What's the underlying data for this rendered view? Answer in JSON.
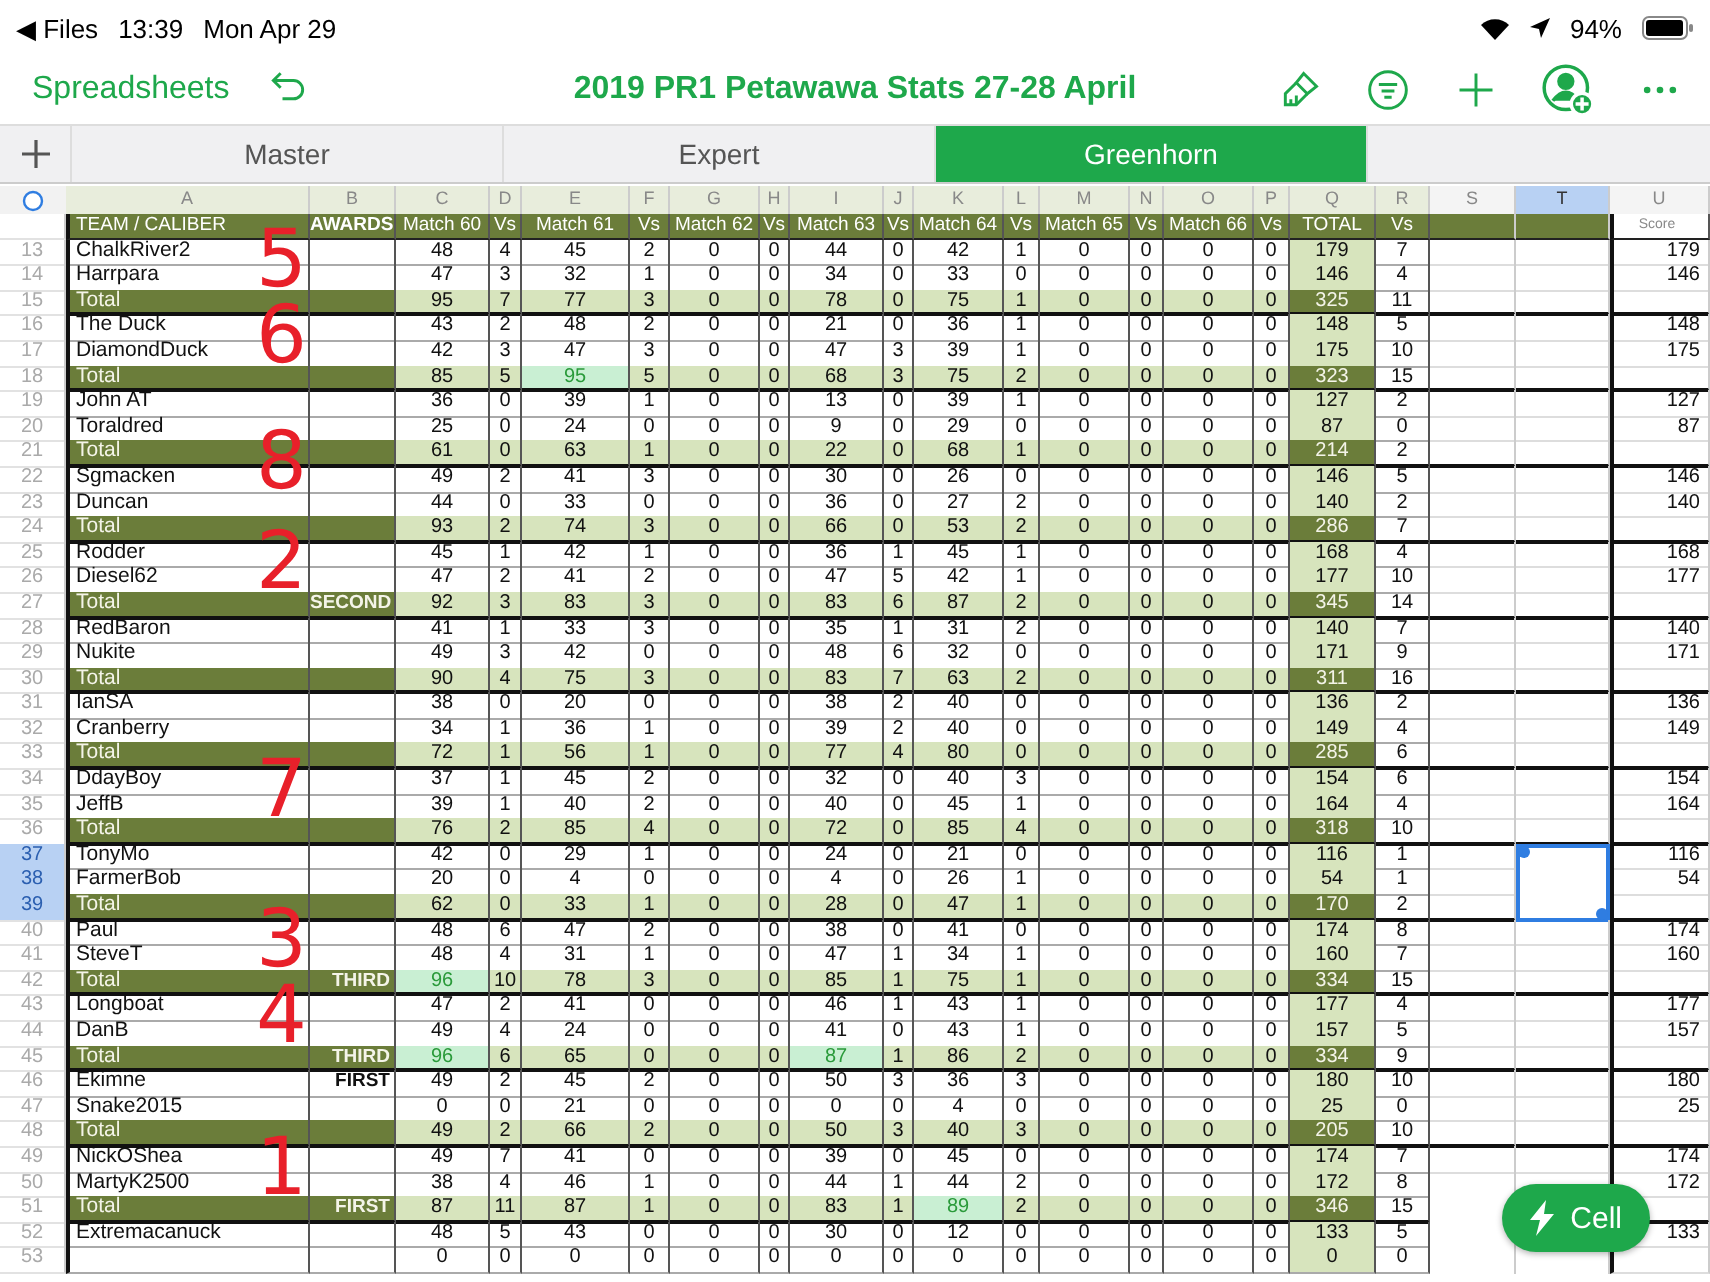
{
  "status_bar": {
    "back": "◀ Files",
    "time": "13:39",
    "date": "Mon Apr 29",
    "battery": "94%"
  },
  "toolbar": {
    "back": "Spreadsheets",
    "title": "2019 PR1 Petawawa Stats 27-28 April"
  },
  "tabs": [
    {
      "label": "Master",
      "selected": false
    },
    {
      "label": "Expert",
      "selected": false
    },
    {
      "label": "Greenhorn",
      "selected": true
    }
  ],
  "column_headers": [
    {
      "label": "A",
      "selected": false
    },
    {
      "label": "B",
      "selected": false
    },
    {
      "label": "C",
      "selected": false
    },
    {
      "label": "D",
      "selected": false
    },
    {
      "label": "E",
      "selected": false
    },
    {
      "label": "F",
      "selected": false
    },
    {
      "label": "G",
      "selected": false
    },
    {
      "label": "H",
      "selected": false
    },
    {
      "label": "I",
      "selected": false
    },
    {
      "label": "J",
      "selected": false
    },
    {
      "label": "K",
      "selected": false
    },
    {
      "label": "L",
      "selected": false
    },
    {
      "label": "M",
      "selected": false
    },
    {
      "label": "N",
      "selected": false
    },
    {
      "label": "O",
      "selected": false
    },
    {
      "label": "P",
      "selected": false
    },
    {
      "label": "Q",
      "selected": false
    },
    {
      "label": "R",
      "selected": false
    },
    {
      "label": "S",
      "selected": false
    },
    {
      "label": "T",
      "selected": true
    },
    {
      "label": "U",
      "selected": false
    }
  ],
  "header_row": [
    "TEAM / CALIBER",
    "AWARDS",
    "Match 60",
    "Vs",
    "Match 61",
    "Vs",
    "Match 62",
    "Vs",
    "Match 63",
    "Vs",
    "Match 64",
    "Vs",
    "Match 65",
    "Vs",
    "Match 66",
    "Vs",
    "TOTAL",
    "Vs"
  ],
  "score_header": "Score",
  "rows": [
    {
      "num": "13",
      "kind": "player",
      "selected": false,
      "name": "ChalkRiver2",
      "cells": [
        "48",
        "4",
        "45",
        "2",
        "0",
        "0",
        "44",
        "0",
        "42",
        "1",
        "0",
        "0",
        "0",
        "0",
        "179",
        "7"
      ],
      "highlighted": [
        false,
        false,
        false,
        false,
        false,
        false,
        false,
        false,
        false,
        false,
        false,
        false,
        false,
        false,
        false,
        false
      ],
      "score": "179"
    },
    {
      "num": "14",
      "kind": "player",
      "selected": false,
      "name": "Harrpara",
      "cells": [
        "47",
        "3",
        "32",
        "1",
        "0",
        "0",
        "34",
        "0",
        "33",
        "0",
        "0",
        "0",
        "0",
        "0",
        "146",
        "4"
      ],
      "highlighted": [
        false,
        false,
        false,
        false,
        false,
        false,
        false,
        false,
        false,
        false,
        false,
        false,
        false,
        false,
        false,
        false
      ],
      "score": "146",
      "ink": "5"
    },
    {
      "num": "15",
      "kind": "total",
      "selected": false,
      "name": "Total",
      "cells": [
        "95",
        "7",
        "77",
        "3",
        "0",
        "0",
        "78",
        "0",
        "75",
        "1",
        "0",
        "0",
        "0",
        "0",
        "325",
        "11"
      ],
      "highlighted": [
        false,
        false,
        false,
        false,
        false,
        false,
        false,
        false,
        false,
        false,
        false,
        false,
        false,
        false,
        false,
        false
      ]
    },
    {
      "num": "16",
      "kind": "player",
      "selected": false,
      "name": "The Duck",
      "cells": [
        "43",
        "2",
        "48",
        "2",
        "0",
        "0",
        "21",
        "0",
        "36",
        "1",
        "0",
        "0",
        "0",
        "0",
        "148",
        "5"
      ],
      "highlighted": [
        false,
        false,
        false,
        false,
        false,
        false,
        false,
        false,
        false,
        false,
        false,
        false,
        false,
        false,
        false,
        false
      ],
      "score": "148"
    },
    {
      "num": "17",
      "kind": "player",
      "selected": false,
      "name": "DiamondDuck",
      "cells": [
        "42",
        "3",
        "47",
        "3",
        "0",
        "0",
        "47",
        "3",
        "39",
        "1",
        "0",
        "0",
        "0",
        "0",
        "175",
        "10"
      ],
      "highlighted": [
        false,
        false,
        false,
        false,
        false,
        false,
        false,
        false,
        false,
        false,
        false,
        false,
        false,
        false,
        false,
        false
      ],
      "score": "175",
      "ink": "6"
    },
    {
      "num": "18",
      "kind": "total",
      "selected": false,
      "name": "Total",
      "cells": [
        "85",
        "5",
        "95",
        "5",
        "0",
        "0",
        "68",
        "3",
        "75",
        "2",
        "0",
        "0",
        "0",
        "0",
        "323",
        "15"
      ],
      "highlighted": [
        false,
        false,
        true,
        false,
        false,
        false,
        false,
        false,
        false,
        false,
        false,
        false,
        false,
        false,
        false,
        false
      ]
    },
    {
      "num": "19",
      "kind": "player",
      "selected": false,
      "name": "John AT",
      "cells": [
        "36",
        "0",
        "39",
        "1",
        "0",
        "0",
        "13",
        "0",
        "39",
        "1",
        "0",
        "0",
        "0",
        "0",
        "127",
        "2"
      ],
      "highlighted": [
        false,
        false,
        false,
        false,
        false,
        false,
        false,
        false,
        false,
        false,
        false,
        false,
        false,
        false,
        false,
        false
      ],
      "score": "127"
    },
    {
      "num": "20",
      "kind": "player",
      "selected": false,
      "name": "Toraldred",
      "cells": [
        "25",
        "0",
        "24",
        "0",
        "0",
        "0",
        "9",
        "0",
        "29",
        "0",
        "0",
        "0",
        "0",
        "0",
        "87",
        "0"
      ],
      "highlighted": [
        false,
        false,
        false,
        false,
        false,
        false,
        false,
        false,
        false,
        false,
        false,
        false,
        false,
        false,
        false,
        false
      ],
      "score": "87"
    },
    {
      "num": "21",
      "kind": "total",
      "selected": false,
      "name": "Total",
      "cells": [
        "61",
        "0",
        "63",
        "1",
        "0",
        "0",
        "22",
        "0",
        "68",
        "1",
        "0",
        "0",
        "0",
        "0",
        "214",
        "2"
      ],
      "highlighted": [
        false,
        false,
        false,
        false,
        false,
        false,
        false,
        false,
        false,
        false,
        false,
        false,
        false,
        false,
        false,
        false
      ]
    },
    {
      "num": "22",
      "kind": "player",
      "selected": false,
      "name": "Sgmacken",
      "cells": [
        "49",
        "2",
        "41",
        "3",
        "0",
        "0",
        "30",
        "0",
        "26",
        "0",
        "0",
        "0",
        "0",
        "0",
        "146",
        "5"
      ],
      "highlighted": [
        false,
        false,
        false,
        false,
        false,
        false,
        false,
        false,
        false,
        false,
        false,
        false,
        false,
        false,
        false,
        false
      ],
      "score": "146",
      "ink": "8"
    },
    {
      "num": "23",
      "kind": "player",
      "selected": false,
      "name": "Duncan",
      "cells": [
        "44",
        "0",
        "33",
        "0",
        "0",
        "0",
        "36",
        "0",
        "27",
        "2",
        "0",
        "0",
        "0",
        "0",
        "140",
        "2"
      ],
      "highlighted": [
        false,
        false,
        false,
        false,
        false,
        false,
        false,
        false,
        false,
        false,
        false,
        false,
        false,
        false,
        false,
        false
      ],
      "score": "140"
    },
    {
      "num": "24",
      "kind": "total",
      "selected": false,
      "name": "Total",
      "cells": [
        "93",
        "2",
        "74",
        "3",
        "0",
        "0",
        "66",
        "0",
        "53",
        "2",
        "0",
        "0",
        "0",
        "0",
        "286",
        "7"
      ],
      "highlighted": [
        false,
        false,
        false,
        false,
        false,
        false,
        false,
        false,
        false,
        false,
        false,
        false,
        false,
        false,
        false,
        false
      ]
    },
    {
      "num": "25",
      "kind": "player",
      "selected": false,
      "name": "Rodder",
      "cells": [
        "45",
        "1",
        "42",
        "1",
        "0",
        "0",
        "36",
        "1",
        "45",
        "1",
        "0",
        "0",
        "0",
        "0",
        "168",
        "4"
      ],
      "highlighted": [
        false,
        false,
        false,
        false,
        false,
        false,
        false,
        false,
        false,
        false,
        false,
        false,
        false,
        false,
        false,
        false
      ],
      "score": "168"
    },
    {
      "num": "26",
      "kind": "player",
      "selected": false,
      "name": "Diesel62",
      "cells": [
        "47",
        "2",
        "41",
        "2",
        "0",
        "0",
        "47",
        "5",
        "42",
        "1",
        "0",
        "0",
        "0",
        "0",
        "177",
        "10"
      ],
      "highlighted": [
        false,
        false,
        false,
        false,
        false,
        false,
        false,
        false,
        false,
        false,
        false,
        false,
        false,
        false,
        false,
        false
      ],
      "score": "177",
      "ink": "2"
    },
    {
      "num": "27",
      "kind": "total",
      "selected": false,
      "name": "Total",
      "award": "SECOND",
      "cells": [
        "92",
        "3",
        "83",
        "3",
        "0",
        "0",
        "83",
        "6",
        "87",
        "2",
        "0",
        "0",
        "0",
        "0",
        "345",
        "14"
      ],
      "highlighted": [
        false,
        false,
        false,
        false,
        false,
        false,
        false,
        false,
        false,
        false,
        false,
        false,
        false,
        false,
        false,
        false
      ]
    },
    {
      "num": "28",
      "kind": "player",
      "selected": false,
      "name": "RedBaron",
      "cells": [
        "41",
        "1",
        "33",
        "3",
        "0",
        "0",
        "35",
        "1",
        "31",
        "2",
        "0",
        "0",
        "0",
        "0",
        "140",
        "7"
      ],
      "highlighted": [
        false,
        false,
        false,
        false,
        false,
        false,
        false,
        false,
        false,
        false,
        false,
        false,
        false,
        false,
        false,
        false
      ],
      "score": "140"
    },
    {
      "num": "29",
      "kind": "player",
      "selected": false,
      "name": "Nukite",
      "cells": [
        "49",
        "3",
        "42",
        "0",
        "0",
        "0",
        "48",
        "6",
        "32",
        "0",
        "0",
        "0",
        "0",
        "0",
        "171",
        "9"
      ],
      "highlighted": [
        false,
        false,
        false,
        false,
        false,
        false,
        false,
        false,
        false,
        false,
        false,
        false,
        false,
        false,
        false,
        false
      ],
      "score": "171"
    },
    {
      "num": "30",
      "kind": "total",
      "selected": false,
      "name": "Total",
      "cells": [
        "90",
        "4",
        "75",
        "3",
        "0",
        "0",
        "83",
        "7",
        "63",
        "2",
        "0",
        "0",
        "0",
        "0",
        "311",
        "16"
      ],
      "highlighted": [
        false,
        false,
        false,
        false,
        false,
        false,
        false,
        false,
        false,
        false,
        false,
        false,
        false,
        false,
        false,
        false
      ]
    },
    {
      "num": "31",
      "kind": "player",
      "selected": false,
      "name": "IanSA",
      "cells": [
        "38",
        "0",
        "20",
        "0",
        "0",
        "0",
        "38",
        "2",
        "40",
        "0",
        "0",
        "0",
        "0",
        "0",
        "136",
        "2"
      ],
      "highlighted": [
        false,
        false,
        false,
        false,
        false,
        false,
        false,
        false,
        false,
        false,
        false,
        false,
        false,
        false,
        false,
        false
      ],
      "score": "136"
    },
    {
      "num": "32",
      "kind": "player",
      "selected": false,
      "name": "Cranberry",
      "cells": [
        "34",
        "1",
        "36",
        "1",
        "0",
        "0",
        "39",
        "2",
        "40",
        "0",
        "0",
        "0",
        "0",
        "0",
        "149",
        "4"
      ],
      "highlighted": [
        false,
        false,
        false,
        false,
        false,
        false,
        false,
        false,
        false,
        false,
        false,
        false,
        false,
        false,
        false,
        false
      ],
      "score": "149"
    },
    {
      "num": "33",
      "kind": "total",
      "selected": false,
      "name": "Total",
      "cells": [
        "72",
        "1",
        "56",
        "1",
        "0",
        "0",
        "77",
        "4",
        "80",
        "0",
        "0",
        "0",
        "0",
        "0",
        "285",
        "6"
      ],
      "highlighted": [
        false,
        false,
        false,
        false,
        false,
        false,
        false,
        false,
        false,
        false,
        false,
        false,
        false,
        false,
        false,
        false
      ]
    },
    {
      "num": "34",
      "kind": "player",
      "selected": false,
      "name": "DdayBoy",
      "cells": [
        "37",
        "1",
        "45",
        "2",
        "0",
        "0",
        "32",
        "0",
        "40",
        "3",
        "0",
        "0",
        "0",
        "0",
        "154",
        "6"
      ],
      "highlighted": [
        false,
        false,
        false,
        false,
        false,
        false,
        false,
        false,
        false,
        false,
        false,
        false,
        false,
        false,
        false,
        false
      ],
      "score": "154"
    },
    {
      "num": "35",
      "kind": "player",
      "selected": false,
      "name": "JeffB",
      "cells": [
        "39",
        "1",
        "40",
        "2",
        "0",
        "0",
        "40",
        "0",
        "45",
        "1",
        "0",
        "0",
        "0",
        "0",
        "164",
        "4"
      ],
      "highlighted": [
        false,
        false,
        false,
        false,
        false,
        false,
        false,
        false,
        false,
        false,
        false,
        false,
        false,
        false,
        false,
        false
      ],
      "score": "164",
      "ink": "7"
    },
    {
      "num": "36",
      "kind": "total",
      "selected": false,
      "name": "Total",
      "cells": [
        "76",
        "2",
        "85",
        "4",
        "0",
        "0",
        "72",
        "0",
        "85",
        "4",
        "0",
        "0",
        "0",
        "0",
        "318",
        "10"
      ],
      "highlighted": [
        false,
        false,
        false,
        false,
        false,
        false,
        false,
        false,
        false,
        false,
        false,
        false,
        false,
        false,
        false,
        false
      ]
    },
    {
      "num": "37",
      "kind": "player",
      "selected": true,
      "name": "TonyMo",
      "cells": [
        "42",
        "0",
        "29",
        "1",
        "0",
        "0",
        "24",
        "0",
        "21",
        "0",
        "0",
        "0",
        "0",
        "0",
        "116",
        "1"
      ],
      "highlighted": [
        false,
        false,
        false,
        false,
        false,
        false,
        false,
        false,
        false,
        false,
        false,
        false,
        false,
        false,
        false,
        false
      ],
      "score": "116"
    },
    {
      "num": "38",
      "kind": "player",
      "selected": true,
      "name": "FarmerBob",
      "cells": [
        "20",
        "0",
        "4",
        "0",
        "0",
        "0",
        "4",
        "0",
        "26",
        "1",
        "0",
        "0",
        "0",
        "0",
        "54",
        "1"
      ],
      "highlighted": [
        false,
        false,
        false,
        false,
        false,
        false,
        false,
        false,
        false,
        false,
        false,
        false,
        false,
        false,
        false,
        false
      ],
      "score": "54"
    },
    {
      "num": "39",
      "kind": "total",
      "selected": true,
      "name": "Total",
      "cells": [
        "62",
        "0",
        "33",
        "1",
        "0",
        "0",
        "28",
        "0",
        "47",
        "1",
        "0",
        "0",
        "0",
        "0",
        "170",
        "2"
      ],
      "highlighted": [
        false,
        false,
        false,
        false,
        false,
        false,
        false,
        false,
        false,
        false,
        false,
        false,
        false,
        false,
        false,
        false
      ]
    },
    {
      "num": "40",
      "kind": "player",
      "selected": false,
      "name": "Paul",
      "cells": [
        "48",
        "6",
        "47",
        "2",
        "0",
        "0",
        "38",
        "0",
        "41",
        "0",
        "0",
        "0",
        "0",
        "0",
        "174",
        "8"
      ],
      "highlighted": [
        false,
        false,
        false,
        false,
        false,
        false,
        false,
        false,
        false,
        false,
        false,
        false,
        false,
        false,
        false,
        false
      ],
      "score": "174"
    },
    {
      "num": "41",
      "kind": "player",
      "selected": false,
      "name": "SteveT",
      "cells": [
        "48",
        "4",
        "31",
        "1",
        "0",
        "0",
        "47",
        "1",
        "34",
        "1",
        "0",
        "0",
        "0",
        "0",
        "160",
        "7"
      ],
      "highlighted": [
        false,
        false,
        false,
        false,
        false,
        false,
        false,
        false,
        false,
        false,
        false,
        false,
        false,
        false,
        false,
        false
      ],
      "score": "160",
      "ink": "3"
    },
    {
      "num": "42",
      "kind": "total",
      "selected": false,
      "name": "Total",
      "award": "THIRD",
      "cells": [
        "96",
        "10",
        "78",
        "3",
        "0",
        "0",
        "85",
        "1",
        "75",
        "1",
        "0",
        "0",
        "0",
        "0",
        "334",
        "15"
      ],
      "highlighted": [
        true,
        false,
        false,
        false,
        false,
        false,
        false,
        false,
        false,
        false,
        false,
        false,
        false,
        false,
        false,
        false
      ]
    },
    {
      "num": "43",
      "kind": "player",
      "selected": false,
      "name": "Longboat",
      "cells": [
        "47",
        "2",
        "41",
        "0",
        "0",
        "0",
        "46",
        "1",
        "43",
        "1",
        "0",
        "0",
        "0",
        "0",
        "177",
        "4"
      ],
      "highlighted": [
        false,
        false,
        false,
        false,
        false,
        false,
        false,
        false,
        false,
        false,
        false,
        false,
        false,
        false,
        false,
        false
      ],
      "score": "177"
    },
    {
      "num": "44",
      "kind": "player",
      "selected": false,
      "name": "DanB",
      "cells": [
        "49",
        "4",
        "24",
        "0",
        "0",
        "0",
        "41",
        "0",
        "43",
        "1",
        "0",
        "0",
        "0",
        "0",
        "157",
        "5"
      ],
      "highlighted": [
        false,
        false,
        false,
        false,
        false,
        false,
        false,
        false,
        false,
        false,
        false,
        false,
        false,
        false,
        false,
        false
      ],
      "score": "157",
      "ink": "4"
    },
    {
      "num": "45",
      "kind": "total",
      "selected": false,
      "name": "Total",
      "award": "THIRD",
      "cells": [
        "96",
        "6",
        "65",
        "0",
        "0",
        "0",
        "87",
        "1",
        "86",
        "2",
        "0",
        "0",
        "0",
        "0",
        "334",
        "9"
      ],
      "highlighted": [
        true,
        false,
        false,
        false,
        false,
        false,
        true,
        false,
        false,
        false,
        false,
        false,
        false,
        false,
        false,
        false
      ]
    },
    {
      "num": "46",
      "kind": "player",
      "selected": false,
      "name": "Ekimne",
      "award": "FIRST",
      "cells": [
        "49",
        "2",
        "45",
        "2",
        "0",
        "0",
        "50",
        "3",
        "36",
        "3",
        "0",
        "0",
        "0",
        "0",
        "180",
        "10"
      ],
      "highlighted": [
        false,
        false,
        false,
        false,
        false,
        false,
        false,
        false,
        false,
        false,
        false,
        false,
        false,
        false,
        false,
        false
      ],
      "score": "180"
    },
    {
      "num": "47",
      "kind": "player",
      "selected": false,
      "name": "Snake2015",
      "cells": [
        "0",
        "0",
        "21",
        "0",
        "0",
        "0",
        "0",
        "0",
        "4",
        "0",
        "0",
        "0",
        "0",
        "0",
        "25",
        "0"
      ],
      "highlighted": [
        false,
        false,
        false,
        false,
        false,
        false,
        false,
        false,
        false,
        false,
        false,
        false,
        false,
        false,
        false,
        false
      ],
      "score": "25"
    },
    {
      "num": "48",
      "kind": "total",
      "selected": false,
      "name": "Total",
      "cells": [
        "49",
        "2",
        "66",
        "2",
        "0",
        "0",
        "50",
        "3",
        "40",
        "3",
        "0",
        "0",
        "0",
        "0",
        "205",
        "10"
      ],
      "highlighted": [
        false,
        false,
        false,
        false,
        false,
        false,
        false,
        false,
        false,
        false,
        false,
        false,
        false,
        false,
        false,
        false
      ]
    },
    {
      "num": "49",
      "kind": "player",
      "selected": false,
      "name": "NickOShea",
      "cells": [
        "49",
        "7",
        "41",
        "0",
        "0",
        "0",
        "39",
        "0",
        "45",
        "0",
        "0",
        "0",
        "0",
        "0",
        "174",
        "7"
      ],
      "highlighted": [
        false,
        false,
        false,
        false,
        false,
        false,
        false,
        false,
        false,
        false,
        false,
        false,
        false,
        false,
        false,
        false
      ],
      "score": "174"
    },
    {
      "num": "50",
      "kind": "player",
      "selected": false,
      "name": "MartyK2500",
      "cells": [
        "38",
        "4",
        "46",
        "1",
        "0",
        "0",
        "44",
        "1",
        "44",
        "2",
        "0",
        "0",
        "0",
        "0",
        "172",
        "8"
      ],
      "highlighted": [
        false,
        false,
        false,
        false,
        false,
        false,
        false,
        false,
        false,
        false,
        false,
        false,
        false,
        false,
        false,
        false
      ],
      "score": "172",
      "ink": "1"
    },
    {
      "num": "51",
      "kind": "total",
      "selected": false,
      "name": "Total",
      "award": "FIRST",
      "cells": [
        "87",
        "11",
        "87",
        "1",
        "0",
        "0",
        "83",
        "1",
        "89",
        "2",
        "0",
        "0",
        "0",
        "0",
        "346",
        "15"
      ],
      "highlighted": [
        false,
        false,
        false,
        false,
        false,
        false,
        false,
        false,
        true,
        false,
        false,
        false,
        false,
        false,
        false,
        false
      ]
    },
    {
      "num": "52",
      "kind": "player",
      "selected": false,
      "name": "Extremacanuck",
      "cells": [
        "48",
        "5",
        "43",
        "0",
        "0",
        "0",
        "30",
        "0",
        "12",
        "0",
        "0",
        "0",
        "0",
        "0",
        "133",
        "5"
      ],
      "highlighted": [
        false,
        false,
        false,
        false,
        false,
        false,
        false,
        false,
        false,
        false,
        false,
        false,
        false,
        false,
        false,
        false
      ],
      "score": "133"
    },
    {
      "num": "53",
      "kind": "player",
      "selected": false,
      "cells": [
        "0",
        "0",
        "0",
        "0",
        "0",
        "0",
        "0",
        "0",
        "0",
        "0",
        "0",
        "0",
        "0",
        "0",
        "0",
        "0"
      ],
      "highlighted": [
        false,
        false,
        false,
        false,
        false,
        false,
        false,
        false,
        false,
        false,
        false,
        false,
        false,
        false,
        false,
        false
      ]
    }
  ],
  "action_button": "Cell"
}
